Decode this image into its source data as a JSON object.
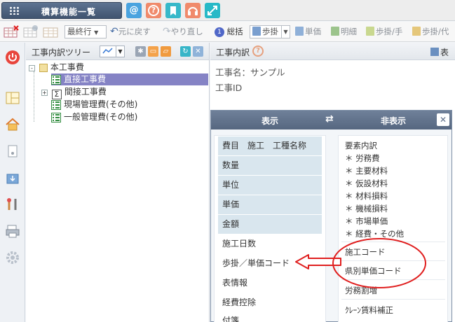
{
  "topbar": {
    "app_title": "積算機能一覧",
    "icons": [
      "grid-icon",
      "at-icon",
      "help-icon",
      "bookmark-icon",
      "headset-icon",
      "expand-icon"
    ],
    "at_glyph": "@",
    "help_glyph": "?"
  },
  "toolbar": {
    "last_row_select": "最終行",
    "undo": "元に戻す",
    "redo": "やり直し",
    "summary_badge": "1",
    "summary": "総括",
    "ratio_select": "歩掛",
    "unit_price": "単価",
    "detail": "明細",
    "ratio_hand": "歩掛/手",
    "ratio_sub": "歩掛/代"
  },
  "tree_panel": {
    "title": "工事内訳ツリー",
    "root": "本工事費",
    "items": [
      {
        "label": "直接工事費",
        "selected": true
      },
      {
        "label": "間接工事費",
        "selected": false
      },
      {
        "label": "現場管理費(その他)",
        "selected": false
      },
      {
        "label": "一般管理費(その他)",
        "selected": false
      }
    ],
    "expander_collapsed": "+",
    "expander_expanded": "-"
  },
  "detail_panel": {
    "title": "工事内訳",
    "help_glyph": "?",
    "right_action": "表",
    "construction_name": "工事名：サンプル",
    "construction_id": "工事ID"
  },
  "dialog": {
    "header_show": "表示",
    "header_swap": "⇄",
    "header_hide": "非表示",
    "close": "✕",
    "visible_columns": [
      {
        "label": "費目　施工　工種名称",
        "highlight": true
      },
      {
        "label": "数量",
        "highlight": true
      },
      {
        "label": "単位",
        "highlight": true
      },
      {
        "label": "単価",
        "highlight": true
      },
      {
        "label": "金額",
        "highlight": true
      },
      {
        "label": "施工日数",
        "highlight": false
      },
      {
        "label": "歩掛／単価コード",
        "highlight": false
      },
      {
        "label": "表情報",
        "highlight": false
      },
      {
        "label": "経費控除",
        "highlight": false
      },
      {
        "label": "付箋",
        "highlight": false
      }
    ],
    "hidden_group_title": "要素内訳",
    "hidden_group_items": [
      "＊ 労務費",
      "＊ 主要材料",
      "＊ 仮設材料",
      "＊ 材料損料",
      "＊ 機械損料",
      "＊ 市場単価",
      "＊ 経費・その他"
    ],
    "hidden_columns": [
      "施工コード",
      "県別単価コード",
      "労務割増",
      "ｸﾚｰﾝ賃料補正"
    ]
  },
  "colors": {
    "accent_red": "#e01f1f",
    "dialog_header": "#5f708a",
    "selected_row": "#8583c5",
    "highlight_row": "#d9e6ee"
  }
}
